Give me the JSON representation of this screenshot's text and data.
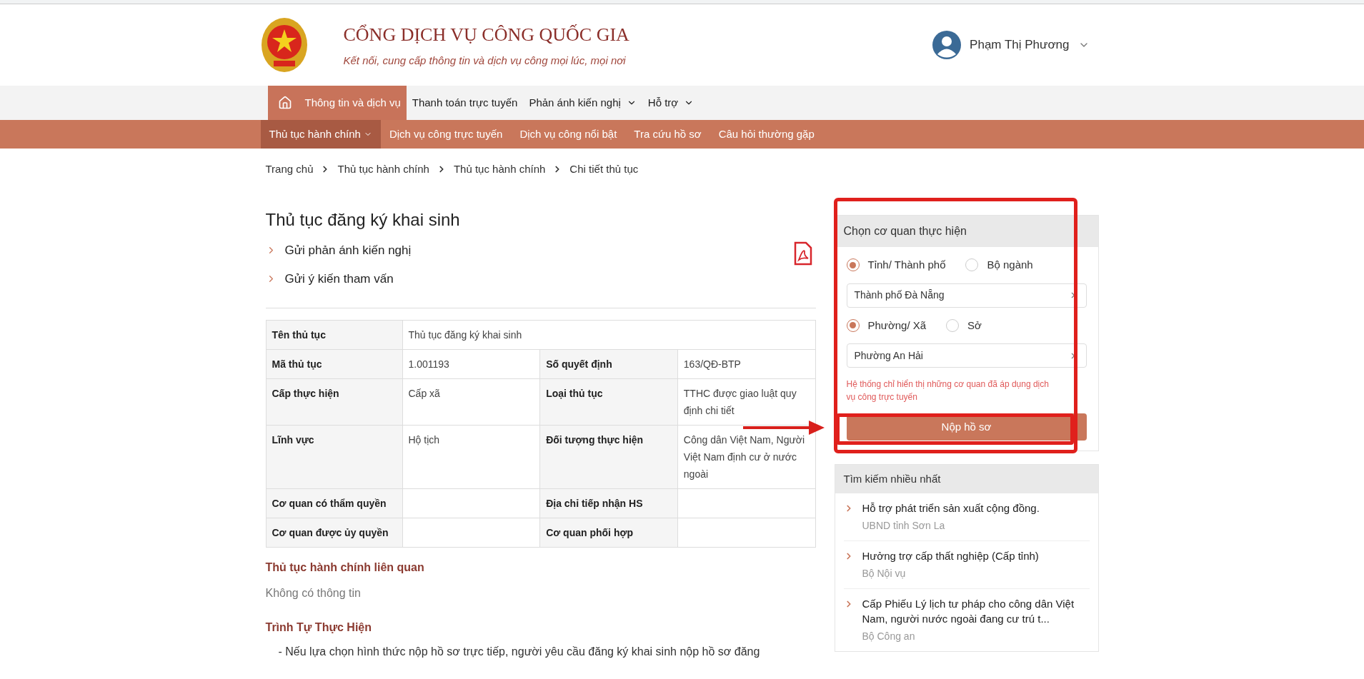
{
  "header": {
    "title": "CỔNG DỊCH VỤ CÔNG QUỐC GIA",
    "subtitle": "Kết nối, cung cấp thông tin và dịch vụ công mọi lúc, mọi nơi",
    "user": "Phạm Thị Phương"
  },
  "nav_primary": [
    {
      "label": "Thông tin và dịch vụ",
      "selected": true,
      "home": true,
      "has_dropdown": false
    },
    {
      "label": "Thanh toán trực tuyến",
      "selected": false,
      "home": false,
      "has_dropdown": false
    },
    {
      "label": "Phản ánh kiến nghị",
      "selected": false,
      "home": false,
      "has_dropdown": true
    },
    {
      "label": "Hỗ trợ",
      "selected": false,
      "home": false,
      "has_dropdown": true
    }
  ],
  "nav_secondary": [
    {
      "label": "Thủ tục hành chính",
      "selected": true,
      "has_dropdown": true
    },
    {
      "label": "Dịch vụ công trực tuyến",
      "selected": false,
      "has_dropdown": false
    },
    {
      "label": "Dịch vụ công nổi bật",
      "selected": false,
      "has_dropdown": false
    },
    {
      "label": "Tra cứu hồ sơ",
      "selected": false,
      "has_dropdown": false
    },
    {
      "label": "Câu hỏi thường gặp",
      "selected": false,
      "has_dropdown": false
    }
  ],
  "breadcrumb": [
    "Trang chủ",
    "Thủ tục hành chính",
    "Thủ tục hành chính",
    "Chi tiết thủ tục"
  ],
  "procedure": {
    "title": "Thủ tục đăng ký khai sinh",
    "links": [
      "Gửi phản ánh kiến nghị",
      "Gửi ý kiến tham vấn"
    ],
    "table": [
      [
        {
          "label": "Tên thủ tục",
          "value": "Thủ tục đăng ký khai sinh"
        }
      ],
      [
        {
          "label": "Mã thủ tục",
          "value": "1.001193"
        },
        {
          "label": "Số quyết định",
          "value": "163/QĐ-BTP"
        }
      ],
      [
        {
          "label": "Cấp thực hiện",
          "value": "Cấp xã"
        },
        {
          "label": "Loại thủ tục",
          "value": "TTHC được giao luật quy định chi tiết"
        }
      ],
      [
        {
          "label": "Lĩnh vực",
          "value": "Hộ tịch"
        },
        {
          "label": "Đối tượng thực hiện",
          "value": "Công dân Việt Nam, Người Việt Nam định cư ở nước ngoài"
        }
      ],
      [
        {
          "label": "Cơ quan có thẩm quyền"
        },
        {
          "label": "Địa chỉ tiếp nhận HS"
        }
      ],
      [
        {
          "label": "Cơ quan được ủy quyền"
        },
        {
          "label": "Cơ quan phối hợp"
        }
      ]
    ]
  },
  "related": {
    "heading": "Thủ tục hành chính liên quan",
    "text": "Không có thông tin"
  },
  "sequence": {
    "heading": "Trình Tự Thực Hiện",
    "text": "- Nếu lựa chọn hình thức nộp hồ sơ trực tiếp, người yêu cầu đăng ký khai sinh nộp hồ sơ đăng"
  },
  "agency_panel": {
    "title": "Chọn cơ quan thực hiện",
    "level_options": [
      {
        "label": "Tỉnh/ Thành phố",
        "selected": true
      },
      {
        "label": "Bộ ngành",
        "selected": false
      }
    ],
    "level_value": "Thành phố Đà Nẵng",
    "unit_options": [
      {
        "label": "Phường/ Xã",
        "selected": true
      },
      {
        "label": "Sở",
        "selected": false
      }
    ],
    "unit_value": "Phường An Hải",
    "note": "Hệ thống chỉ hiển thị những cơ quan đã áp dụng dịch vụ công trực tuyến",
    "button": "Nộp hồ sơ"
  },
  "popular": {
    "title": "Tìm kiếm nhiều nhất",
    "items": [
      {
        "title": "Hỗ trợ phát triển sản xuất cộng đồng.",
        "agency": "UBND tỉnh Sơn La"
      },
      {
        "title": "Hưởng trợ cấp thất nghiệp (Cấp tỉnh)",
        "agency": "Bộ Nội vụ"
      },
      {
        "title": "Cấp Phiếu Lý lịch tư pháp cho công dân Việt Nam, người nước ngoài đang cư trú t...",
        "agency": "Bộ Công an"
      }
    ]
  }
}
